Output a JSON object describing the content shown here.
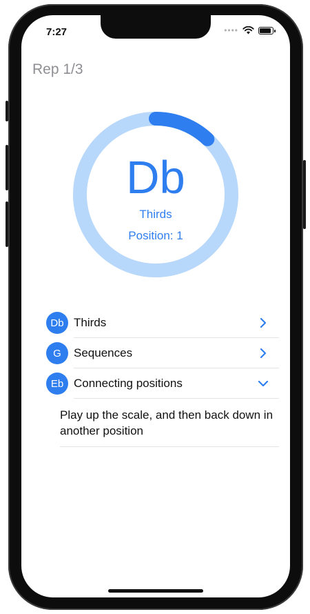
{
  "status": {
    "time": "7:27",
    "signal_icon": "cellular-dots-icon",
    "wifi_icon": "wifi-icon",
    "battery_icon": "battery-icon"
  },
  "header": {
    "rep": "Rep 1/3"
  },
  "progress": {
    "fraction": 0.12,
    "track_color": "#b7d7fb",
    "fill_color": "#2f7ef0"
  },
  "current": {
    "key": "Db",
    "mode": "Thirds",
    "position": "Position: 1"
  },
  "list": {
    "items": [
      {
        "badge": "Db",
        "label": "Thirds",
        "chevron": "chevron-right-icon"
      },
      {
        "badge": "G",
        "label": "Sequences",
        "chevron": "chevron-right-icon"
      },
      {
        "badge": "Eb",
        "label": "Connecting positions",
        "chevron": "chevron-down-icon"
      }
    ],
    "expanded_text": "Play up the scale, and then back down in another position"
  }
}
